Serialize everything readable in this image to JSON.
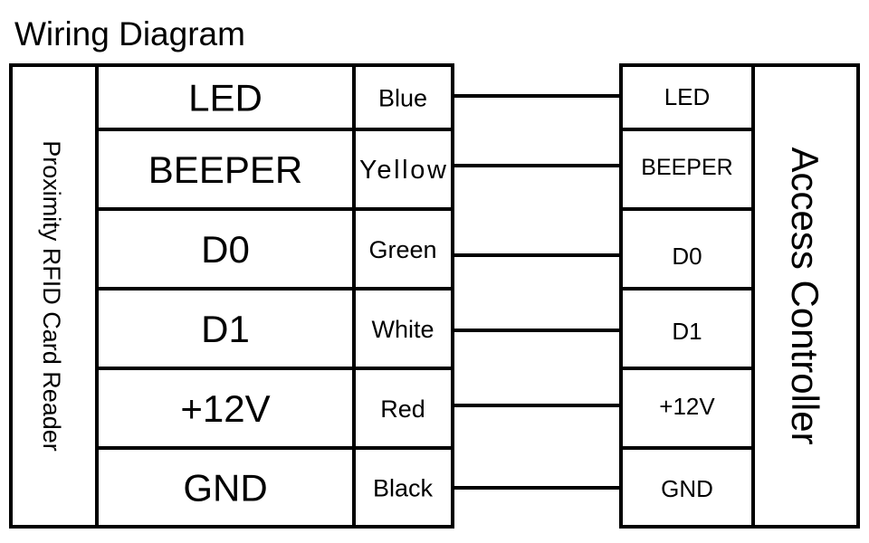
{
  "title": "Wiring Diagram",
  "reader": {
    "name": "Proximity RFID Card Reader",
    "pins": [
      "LED",
      "BEEPER",
      "D0",
      "D1",
      "+12V",
      "GND"
    ],
    "wire_colors": [
      "Blue",
      "Yellow",
      "Green",
      "White",
      "Red",
      "Black"
    ]
  },
  "controller": {
    "name": "Access Controller",
    "terminals": [
      "LED",
      "BEEPER",
      "D0",
      "D1",
      "+12V",
      "GND"
    ]
  },
  "colors": {
    "line": "#000000",
    "background": "#ffffff"
  }
}
